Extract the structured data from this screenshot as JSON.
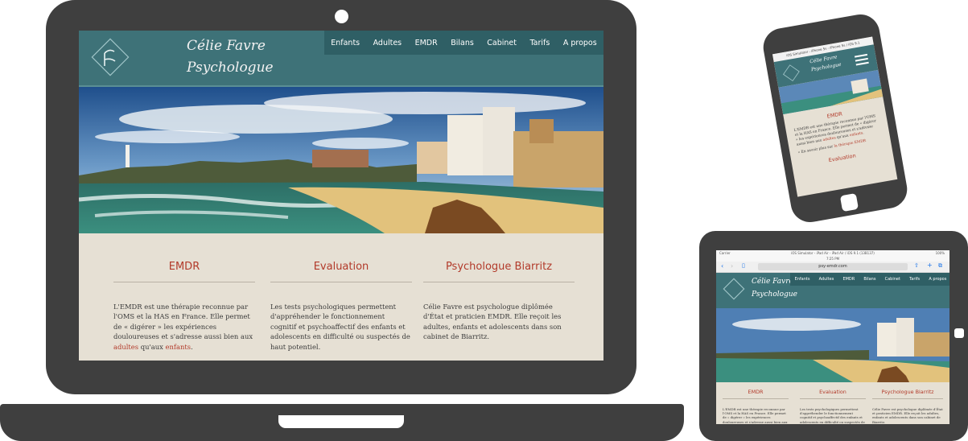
{
  "brand": {
    "name": "Célie Favre",
    "title": "Psychologue"
  },
  "nav": {
    "items": [
      "Enfants",
      "Adultes",
      "EMDR",
      "Bilans",
      "Cabinet",
      "Tarifs",
      "A propos"
    ]
  },
  "sections": [
    {
      "title": "EMDR",
      "text_before": "L'EMDR est une thérapie reconnue par l'OMS et la HAS en France. Elle permet de « digérer » les expériences douloureuses et s'adresse aussi bien aux ",
      "link1": "adultes",
      "text_middle": " qu'aux ",
      "link2": "enfants",
      "text_after": "."
    },
    {
      "title": "Evaluation",
      "text": "Les tests psychologiques permettent d'appréhender le fonctionnement cognitif et psychoaffectif des enfants et adolescents en difficulté ou suspectés de haut potentiel."
    },
    {
      "title": "Psychologue Biarritz",
      "text": "Célie Favre est psychologue diplômée d'État et praticien EMDR. Elle reçoit les adultes, enfants et adolescents dans son cabinet de Biarritz."
    }
  ],
  "phone": {
    "status": "iOS Simulator - iPhone 5s - iPhone 5s / iOS 9.1",
    "section_title": "EMDR",
    "text": "L'EMDR est une thérapie reconnue par l'OMS et la HAS en France. Elle permet de « digérer » les expériences douloureuses et s'adresse aussi bien aux ",
    "link1": "adultes",
    "text_middle": " qu'aux ",
    "link2": "enfants",
    "text_after": ".",
    "more_prefix": "» En savoir plus sur ",
    "more_link": "la thérapie EMDR",
    "next_title": "Evaluation"
  },
  "tablet": {
    "status": "iOS Simulator - iPad Air - iPad Air / iOS 9.1 (13B137)",
    "time": "7:25 PM",
    "carrier": "Carrier",
    "battery": "100%",
    "url": "psy-emdr.com"
  },
  "colors": {
    "accent": "#b23a2a",
    "header": "#3e7278",
    "nav": "#2f5f65",
    "band": "#e6e0d4",
    "device": "#3f3f3f"
  }
}
